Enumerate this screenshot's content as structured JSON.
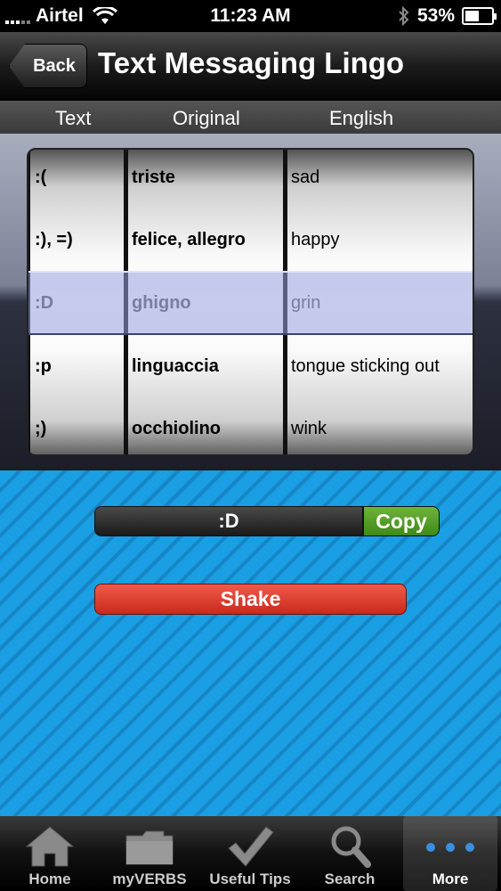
{
  "status_bar": {
    "carrier": "Airtel",
    "time": "11:23 AM",
    "battery": "53%",
    "battery_level": 0.53
  },
  "nav": {
    "back_label": "Back",
    "title": "Text Messaging Lingo"
  },
  "columns": {
    "text": "Text",
    "original": "Original",
    "english": "English"
  },
  "rows": [
    {
      "text": ":(",
      "original": "triste",
      "english": "sad"
    },
    {
      "text": ":), =)",
      "original": "felice, allegro",
      "english": "happy"
    },
    {
      "text": ":D",
      "original": "ghigno",
      "english": "grin"
    },
    {
      "text": ":p",
      "original": "linguaccia",
      "english": "tongue sticking out"
    },
    {
      "text": ";)",
      "original": "occhiolino",
      "english": "wink"
    }
  ],
  "selected_row": 2,
  "result": {
    "value": ":D",
    "copy_label": "Copy"
  },
  "shake_label": "Shake",
  "tabs": [
    {
      "label": "Home",
      "icon": "home-icon"
    },
    {
      "label": "myVERBS",
      "icon": "folder-icon"
    },
    {
      "label": "Useful Tips",
      "icon": "checkmark-icon"
    },
    {
      "label": "Search",
      "icon": "magnifier-icon"
    },
    {
      "label": "More",
      "icon": "more-dots-icon",
      "active": true
    }
  ],
  "colors": {
    "blue_bg": "#1a9ee4",
    "copy_green": "#4f9a22",
    "shake_red": "#e03a2b"
  }
}
